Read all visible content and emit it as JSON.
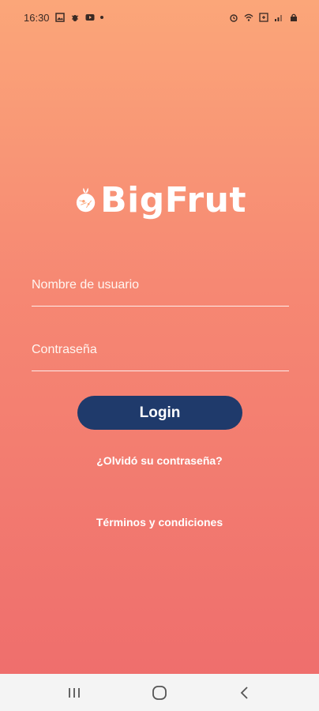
{
  "status_bar": {
    "time": "16:30",
    "left_icons": [
      "image-icon",
      "bug-icon",
      "youtube-icon"
    ],
    "right_icons": [
      "alarm-icon",
      "wifi-icon",
      "battery-saver-icon",
      "signal-icon",
      "lock-icon"
    ]
  },
  "logo": {
    "text": "BigFrut"
  },
  "form": {
    "username_placeholder": "Nombre de usuario",
    "password_placeholder": "Contraseña",
    "login_label": "Login"
  },
  "links": {
    "forgot_password": "¿Olvidó su contraseña?",
    "terms": "Términos y condiciones"
  },
  "nav_bar": {
    "buttons": [
      "recents-icon",
      "home-icon",
      "back-icon"
    ]
  },
  "colors": {
    "gradient_top": "#fba679",
    "gradient_bottom": "#ee6c6c",
    "login_button": "#1f3a6b"
  }
}
